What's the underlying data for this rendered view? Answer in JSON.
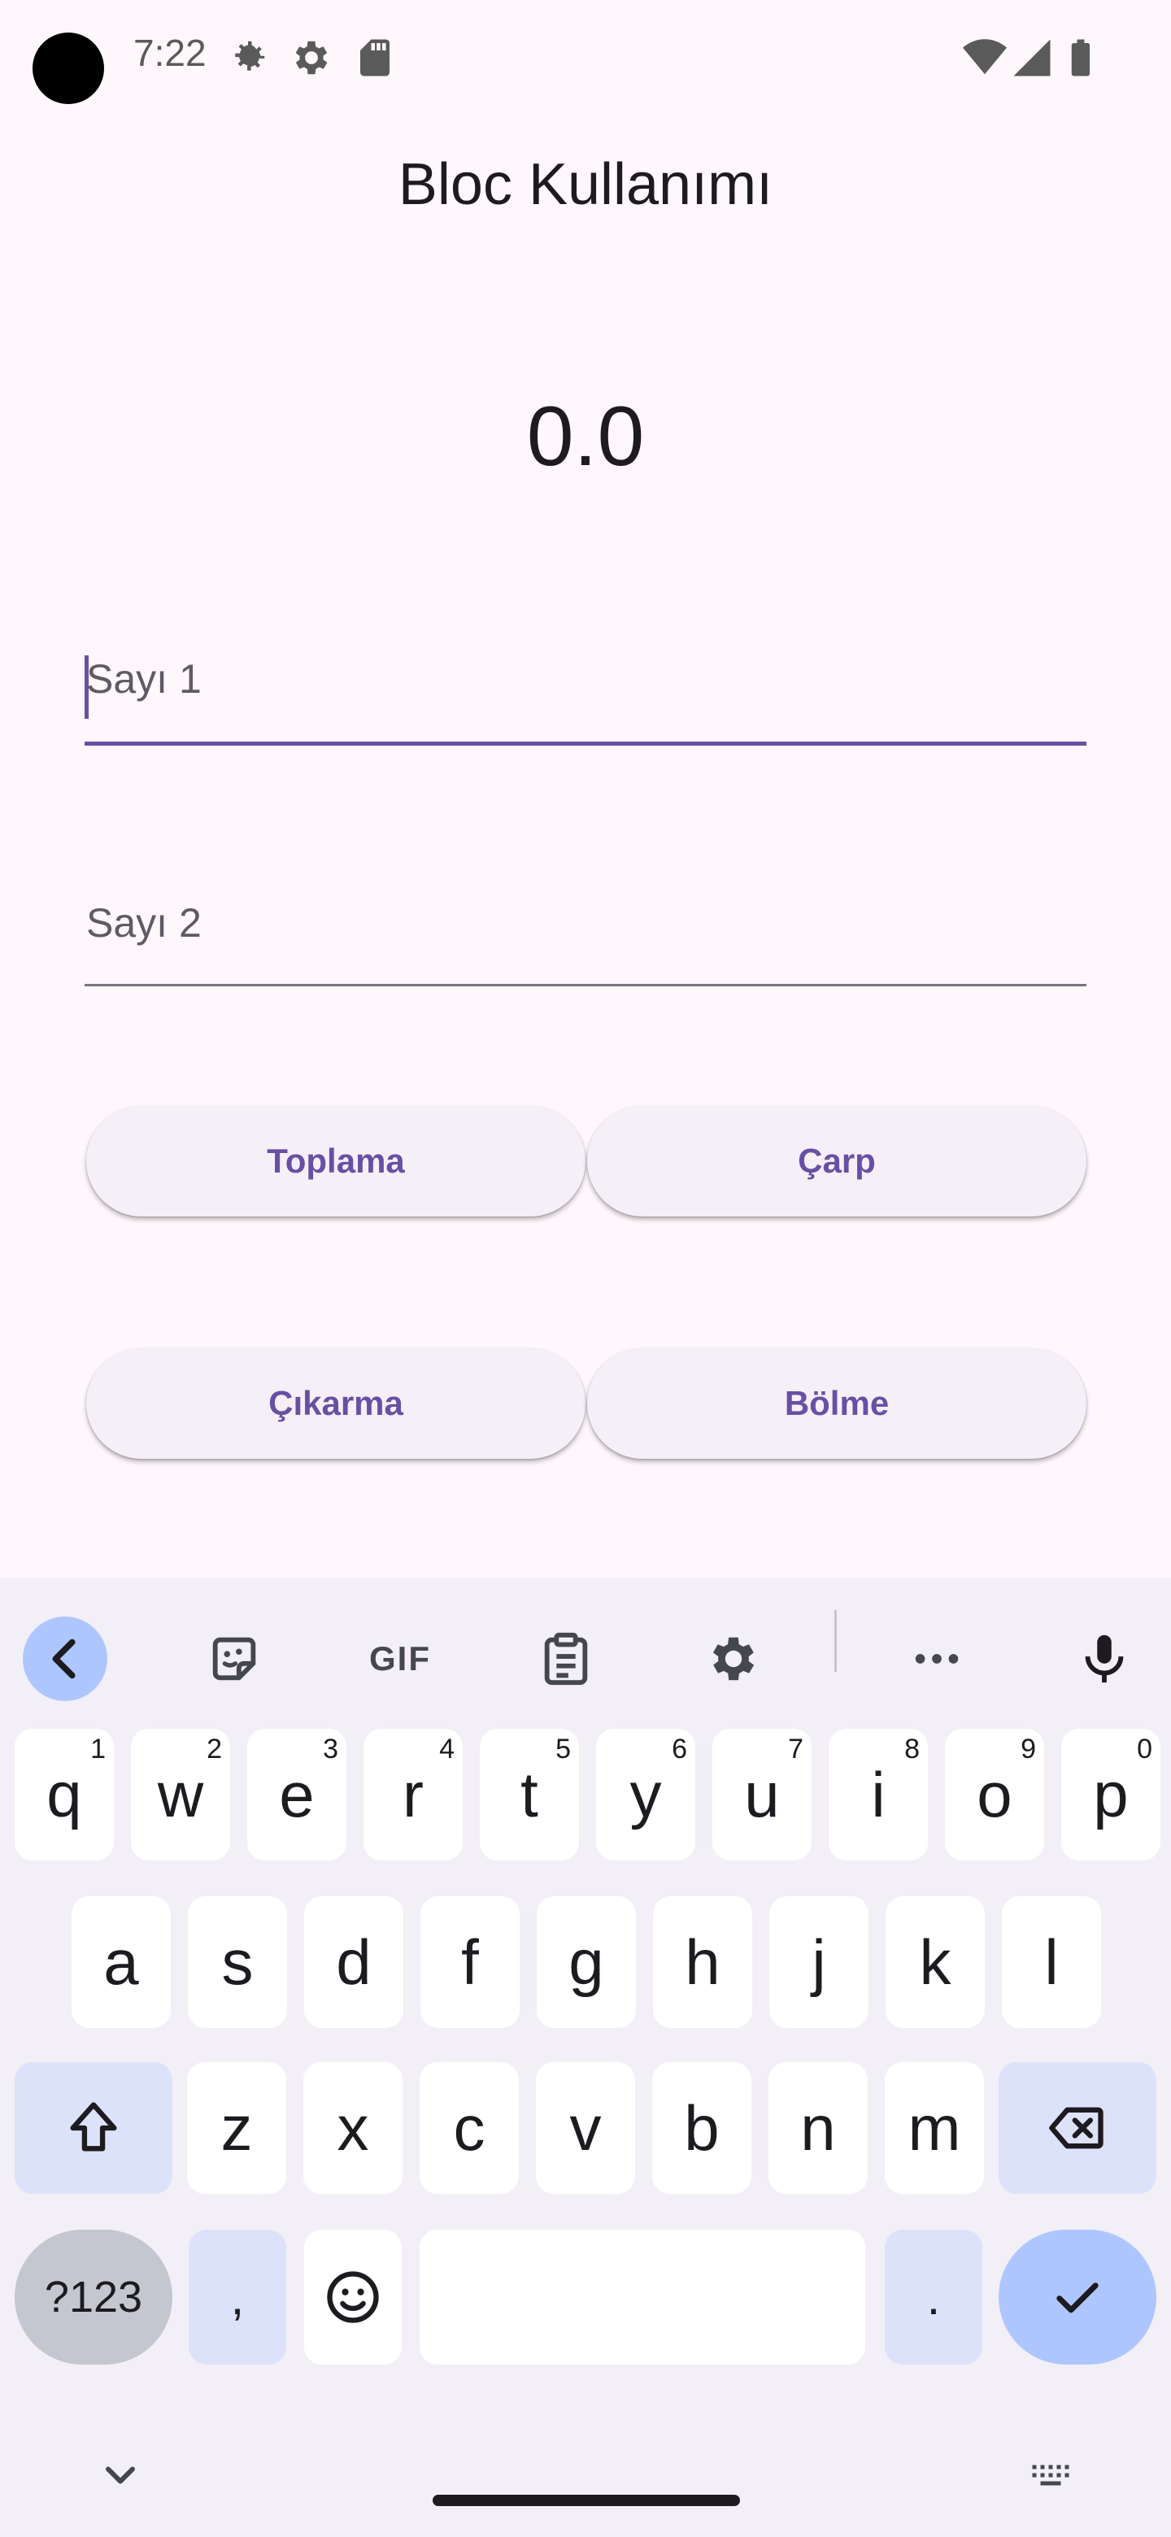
{
  "status_bar": {
    "time": "7:22",
    "icons": [
      "settings-gear-icon",
      "settings-icon",
      "sd-card-icon",
      "wifi-icon",
      "signal-icon",
      "battery-icon"
    ]
  },
  "app": {
    "title": "Bloc Kullanımı",
    "result": "0.0",
    "field1_placeholder": "Sayı 1",
    "field2_placeholder": "Sayı 2",
    "buttons": {
      "add": "Toplama",
      "multiply": "Çarp",
      "subtract": "Çıkarma",
      "divide": "Bölme"
    }
  },
  "keyboard": {
    "toolbar": {
      "gif_label": "GIF",
      "icons": [
        "back-chevron-icon",
        "sticker-icon",
        "clipboard-icon",
        "settings-icon",
        "more-icon",
        "mic-icon"
      ]
    },
    "row1": [
      {
        "k": "q",
        "h": "1"
      },
      {
        "k": "w",
        "h": "2"
      },
      {
        "k": "e",
        "h": "3"
      },
      {
        "k": "r",
        "h": "4"
      },
      {
        "k": "t",
        "h": "5"
      },
      {
        "k": "y",
        "h": "6"
      },
      {
        "k": "u",
        "h": "7"
      },
      {
        "k": "i",
        "h": "8"
      },
      {
        "k": "o",
        "h": "9"
      },
      {
        "k": "p",
        "h": "0"
      }
    ],
    "row2": [
      "a",
      "s",
      "d",
      "f",
      "g",
      "h",
      "j",
      "k",
      "l"
    ],
    "row3": [
      "z",
      "x",
      "c",
      "v",
      "b",
      "n",
      "m"
    ],
    "symbols_label": "?123",
    "comma": ",",
    "period": ".",
    "colors": {
      "accent": "#6750a4",
      "mod_key": "#dce2f9",
      "enter_key": "#aec6ff",
      "symbols_key": "#c4c6d0"
    }
  }
}
